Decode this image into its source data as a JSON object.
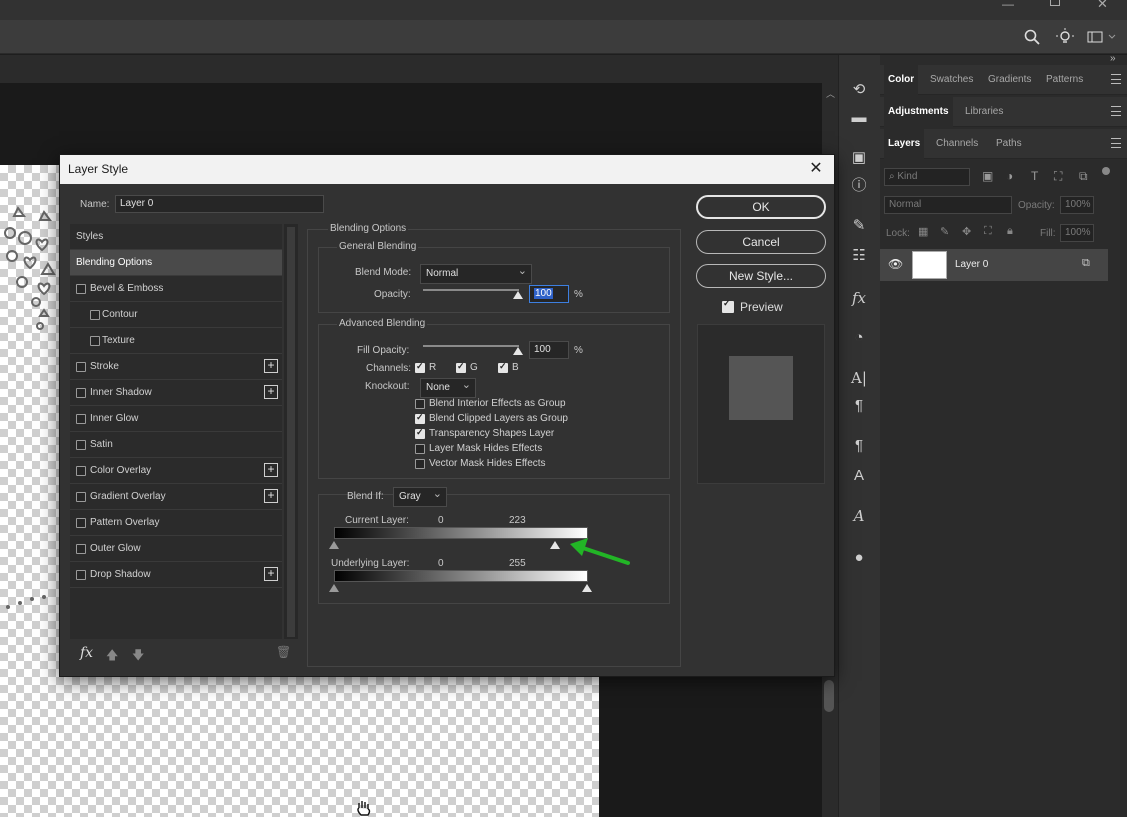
{
  "dialog": {
    "title": "Layer Style",
    "name_label": "Name:",
    "name_value": "Layer 0",
    "buttons": {
      "ok": "OK",
      "cancel": "Cancel",
      "new_style": "New Style..."
    },
    "preview_label": "Preview",
    "preview_checked": true,
    "styles_list": [
      {
        "label": "Styles",
        "has_checkbox": false,
        "selected": false,
        "plus": false,
        "indent": false
      },
      {
        "label": "Blending Options",
        "has_checkbox": false,
        "selected": true,
        "plus": false,
        "indent": false
      },
      {
        "label": "Bevel & Emboss",
        "has_checkbox": true,
        "selected": false,
        "plus": false,
        "indent": false
      },
      {
        "label": "Contour",
        "has_checkbox": true,
        "selected": false,
        "plus": false,
        "indent": true
      },
      {
        "label": "Texture",
        "has_checkbox": true,
        "selected": false,
        "plus": false,
        "indent": true
      },
      {
        "label": "Stroke",
        "has_checkbox": true,
        "selected": false,
        "plus": true,
        "indent": false
      },
      {
        "label": "Inner Shadow",
        "has_checkbox": true,
        "selected": false,
        "plus": true,
        "indent": false
      },
      {
        "label": "Inner Glow",
        "has_checkbox": true,
        "selected": false,
        "plus": false,
        "indent": false
      },
      {
        "label": "Satin",
        "has_checkbox": true,
        "selected": false,
        "plus": false,
        "indent": false
      },
      {
        "label": "Color Overlay",
        "has_checkbox": true,
        "selected": false,
        "plus": true,
        "indent": false
      },
      {
        "label": "Gradient Overlay",
        "has_checkbox": true,
        "selected": false,
        "plus": true,
        "indent": false
      },
      {
        "label": "Pattern Overlay",
        "has_checkbox": true,
        "selected": false,
        "plus": false,
        "indent": false
      },
      {
        "label": "Outer Glow",
        "has_checkbox": true,
        "selected": false,
        "plus": false,
        "indent": false
      },
      {
        "label": "Drop Shadow",
        "has_checkbox": true,
        "selected": false,
        "plus": true,
        "indent": false
      }
    ],
    "blending": {
      "section_title": "Blending Options",
      "general_title": "General Blending",
      "blend_mode_label": "Blend Mode:",
      "blend_mode_value": "Normal",
      "opacity_label": "Opacity:",
      "opacity_value": "100",
      "percent": "%",
      "advanced_title": "Advanced Blending",
      "fill_opacity_label": "Fill Opacity:",
      "fill_opacity_value": "100",
      "channels_label": "Channels:",
      "channels": [
        {
          "label": "R",
          "checked": true
        },
        {
          "label": "G",
          "checked": true
        },
        {
          "label": "B",
          "checked": true
        }
      ],
      "knockout_label": "Knockout:",
      "knockout_value": "None",
      "options": [
        {
          "label": "Blend Interior Effects as Group",
          "checked": false
        },
        {
          "label": "Blend Clipped Layers as Group",
          "checked": true
        },
        {
          "label": "Transparency Shapes Layer",
          "checked": true
        },
        {
          "label": "Layer Mask Hides Effects",
          "checked": false
        },
        {
          "label": "Vector Mask Hides Effects",
          "checked": false
        }
      ],
      "blend_if_label": "Blend If:",
      "blend_if_value": "Gray",
      "current_layer_label": "Current Layer:",
      "current_layer_low": "0",
      "current_layer_high": "223",
      "underlying_layer_label": "Underlying Layer:",
      "underlying_layer_low": "0",
      "underlying_layer_high": "255"
    }
  },
  "panels": {
    "tabs_row1": [
      "Color",
      "Swatches",
      "Gradients",
      "Patterns"
    ],
    "tabs_row2": [
      "Adjustments",
      "Libraries"
    ],
    "tabs_row3": [
      "Layers",
      "Channels",
      "Paths"
    ],
    "kind_placeholder": "Kind",
    "blend_mode": "Normal",
    "opacity_label": "Opacity:",
    "opacity_value": "100%",
    "lock_label": "Lock:",
    "fill_label": "Fill:",
    "fill_value": "100%",
    "layer_name": "Layer 0"
  },
  "colors": {
    "accent_arrow": "#22b526",
    "dialog_bg": "#323232",
    "panel_bg": "#2b2b2b"
  }
}
